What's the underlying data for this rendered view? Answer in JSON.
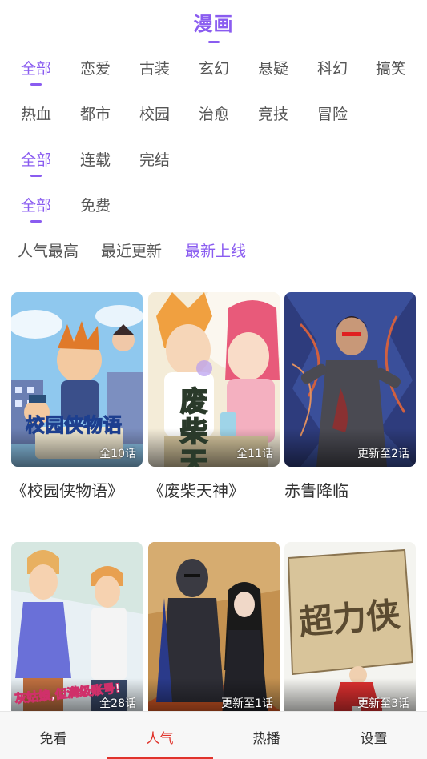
{
  "page": {
    "title": "漫画"
  },
  "filters": {
    "genres": [
      {
        "label": "全部",
        "active": true
      },
      {
        "label": "恋爱",
        "active": false
      },
      {
        "label": "古装",
        "active": false
      },
      {
        "label": "玄幻",
        "active": false
      },
      {
        "label": "悬疑",
        "active": false
      },
      {
        "label": "科幻",
        "active": false
      },
      {
        "label": "搞笑",
        "active": false
      },
      {
        "label": "热血",
        "active": false
      },
      {
        "label": "都市",
        "active": false
      },
      {
        "label": "校园",
        "active": false
      },
      {
        "label": "治愈",
        "active": false
      },
      {
        "label": "竞技",
        "active": false
      },
      {
        "label": "冒险",
        "active": false
      }
    ],
    "status": [
      {
        "label": "全部",
        "active": true
      },
      {
        "label": "连载",
        "active": false
      },
      {
        "label": "完结",
        "active": false
      }
    ],
    "price": [
      {
        "label": "全部",
        "active": true
      },
      {
        "label": "免费",
        "active": false
      }
    ]
  },
  "sort": [
    {
      "label": "人气最高",
      "active": false
    },
    {
      "label": "最近更新",
      "active": false
    },
    {
      "label": "最新上线",
      "active": true
    }
  ],
  "comics": [
    {
      "title": "《校园侠物语》",
      "badge": "全10话",
      "cover_art": "校园侠物语"
    },
    {
      "title": "《废柴天神》",
      "badge": "全11话",
      "cover_art": "废柴天神"
    },
    {
      "title": "赤眚降临",
      "badge": "更新至2话",
      "cover_art": ""
    },
    {
      "title": "",
      "badge": "全28话",
      "cover_art": "灰姑娘,但满级账号!"
    },
    {
      "title": "",
      "badge": "更新至1话",
      "cover_art": ""
    },
    {
      "title": "",
      "badge": "更新至3话",
      "cover_art": "超力侠"
    }
  ],
  "tabs": [
    {
      "label": "免看",
      "active": false
    },
    {
      "label": "人气",
      "active": true
    },
    {
      "label": "热播",
      "active": false
    },
    {
      "label": "设置",
      "active": false
    }
  ],
  "colors": {
    "accent": "#8a5cf0",
    "tab_active": "#e0332b"
  }
}
